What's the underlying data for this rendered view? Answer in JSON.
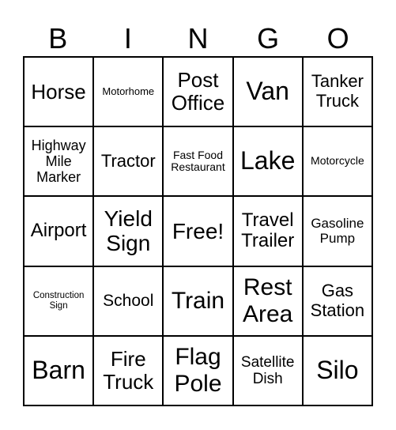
{
  "header": [
    "B",
    "I",
    "N",
    "G",
    "O"
  ],
  "cells": [
    "Horse",
    "Motorhome",
    "Post\nOffice",
    "Van",
    "Tanker\nTruck",
    "Highway\nMile\nMarker",
    "Tractor",
    "Fast Food\nRestaurant",
    "Lake",
    "Motorcycle",
    "Airport",
    "Yield\nSign",
    "Free!",
    "Travel\nTrailer",
    "Gasoline\nPump",
    "Construction\nSign",
    "School",
    "Train",
    "Rest\nArea",
    "Gas\nStation",
    "Barn",
    "Fire\nTruck",
    "Flag\nPole",
    "Satellite\nDish",
    "Silo"
  ]
}
